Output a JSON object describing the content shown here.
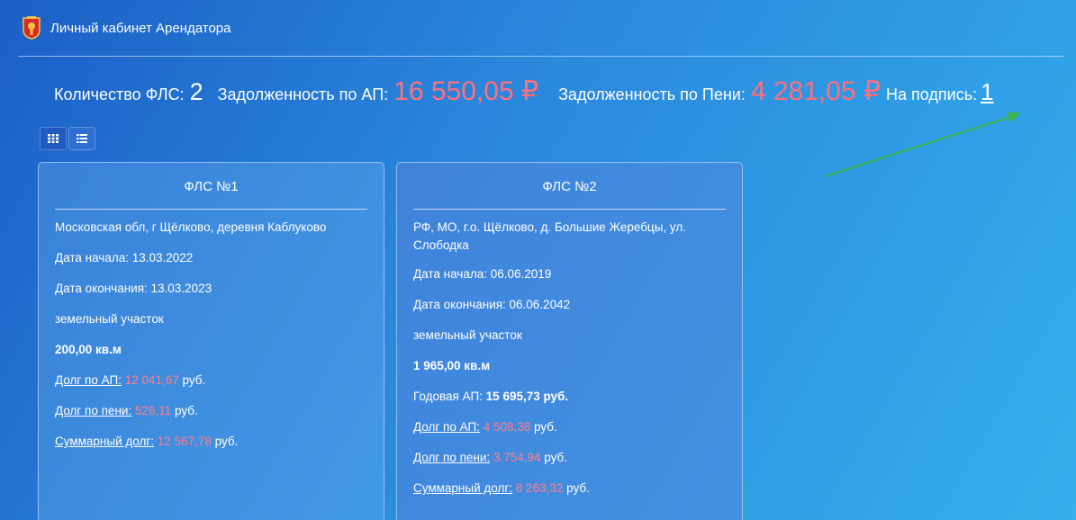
{
  "header": {
    "app_title": "Личный кабинет Арендатора",
    "crest_icon": "moscow-region-crest-icon"
  },
  "stats": {
    "fls_count_label": "Количество ФЛС:",
    "fls_count_value": "2",
    "ap_debt_label": "Задолженность по АП:",
    "ap_debt_value": "16 550,05 ₽",
    "peni_debt_label": "Задолженность по Пени:",
    "peni_debt_value": "4 281,05 ₽",
    "to_sign_label": "На подпись:",
    "to_sign_value": "1"
  },
  "view_toggle": {
    "grid_icon": "grid-icon",
    "list_icon": "list-icon"
  },
  "cards": [
    {
      "title": "ФЛС №1",
      "address": "Московская обл, г Щёлково, деревня Каблуково",
      "start_date": "Дата начала: 13.03.2022",
      "end_date": "Дата окончания: 13.03.2023",
      "type": "земельный участок",
      "area": "200,00 кв.м",
      "ap_debt_label": "Долг по АП:",
      "ap_debt_value": "12 041,67",
      "peni_debt_label": "Долг по пени:",
      "peni_debt_value": "526,11",
      "total_debt_label": "Суммарный долг:",
      "total_debt_value": "12 567,78",
      "currency": "руб."
    },
    {
      "title": "ФЛС №2",
      "address": "РФ, МО, г.о. Щёлково, д. Большие Жеребцы, ул. Слободка",
      "start_date": "Дата начала: 06.06.2019",
      "end_date": "Дата окончания: 06.06.2042",
      "type": "земельный участок",
      "area": "1 965,00 кв.м",
      "annual_ap_label": "Годовая АП:",
      "annual_ap_value": "15 695,73 руб.",
      "ap_debt_label": "Долг по АП:",
      "ap_debt_value": "4 508,38",
      "peni_debt_label": "Долг по пени:",
      "peni_debt_value": "3 754,94",
      "total_debt_label": "Суммарный долг:",
      "total_debt_value": "8 263,32",
      "currency": "руб."
    }
  ],
  "colors": {
    "debt_red": "#ff6f7d",
    "arrow_green": "#3bb34a"
  }
}
